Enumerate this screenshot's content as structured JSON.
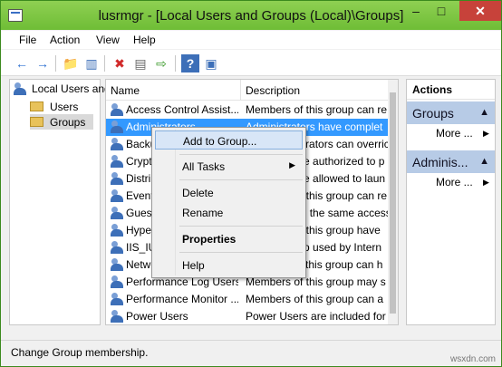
{
  "window": {
    "title": "lusrmgr - [Local Users and Groups (Local)\\Groups]",
    "min": "–",
    "max": "□",
    "close": "✕"
  },
  "menu": [
    "File",
    "Action",
    "View",
    "Help"
  ],
  "toolbar": {
    "back": "←",
    "forward": "→",
    "up": "📁",
    "show_hide": "▥",
    "delete": "✖",
    "properties": "▤",
    "export": "⇨",
    "help": "?",
    "console": "▣"
  },
  "tree": {
    "root": "Local Users and Groups (Local)",
    "items": [
      "Users",
      "Groups"
    ]
  },
  "list": {
    "columns": [
      "Name",
      "Description"
    ],
    "rows": [
      {
        "name": "Access Control Assist...",
        "desc": "Members of this group can re"
      },
      {
        "name": "Administrators",
        "desc": "Administrators have complet"
      },
      {
        "name": "Backup Operators",
        "desc": "Backup Operators can overric"
      },
      {
        "name": "Cryptographic Operators",
        "desc": "Members are authorized to p"
      },
      {
        "name": "Distributed COM Users",
        "desc": "Members are allowed to laun"
      },
      {
        "name": "Event Log Readers",
        "desc": "Members of this group can re"
      },
      {
        "name": "Guests",
        "desc": "Guests have the same access"
      },
      {
        "name": "Hyper-V Administrators",
        "desc": "Members of this group have"
      },
      {
        "name": "IIS_IUSRS",
        "desc": "Built-in group used by Intern"
      },
      {
        "name": "Network Configuration Operators",
        "desc": "Members in this group can h"
      },
      {
        "name": "Performance Log Users",
        "desc": "Members of this group may s"
      },
      {
        "name": "Performance Monitor ...",
        "desc": "Members of this group can a"
      },
      {
        "name": "Power Users",
        "desc": "Power Users are included for"
      }
    ]
  },
  "actions": {
    "header": "Actions",
    "sections": [
      {
        "title": "Groups",
        "more": "More ..."
      },
      {
        "title": "Adminis...",
        "more": "More ..."
      }
    ]
  },
  "context_menu": {
    "add_to_group": "Add to Group...",
    "all_tasks": "All Tasks",
    "delete": "Delete",
    "rename": "Rename",
    "properties": "Properties",
    "help": "Help",
    "submenu_arrow": "▶"
  },
  "status": "Change Group membership.",
  "watermark": "wsxdn.com"
}
